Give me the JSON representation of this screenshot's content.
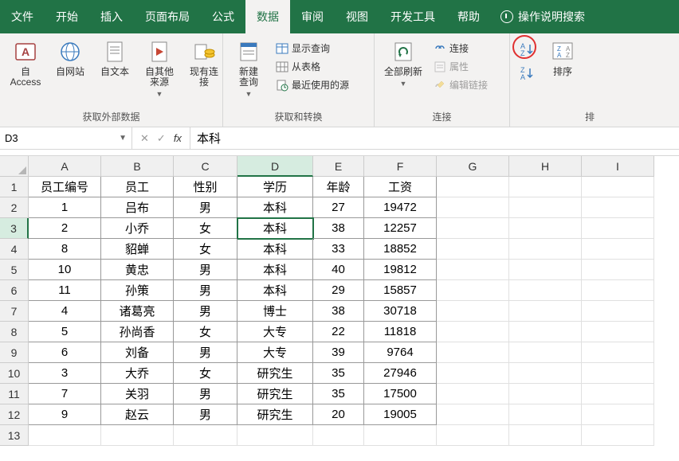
{
  "tabs": [
    "文件",
    "开始",
    "插入",
    "页面布局",
    "公式",
    "数据",
    "审阅",
    "视图",
    "开发工具",
    "帮助"
  ],
  "active_tab_index": 5,
  "tell_me": "操作说明搜索",
  "ribbon": {
    "group_ext": {
      "label": "获取外部数据",
      "btns": [
        "自 Access",
        "自网站",
        "自文本",
        "自其他来源",
        "现有连接"
      ]
    },
    "group_get": {
      "label": "获取和转换",
      "new_query": "新建\n查询",
      "show_query": "显示查询",
      "from_table": "从表格",
      "recent": "最近使用的源"
    },
    "group_conn": {
      "label": "连接",
      "refresh": "全部刷新",
      "connections": "连接",
      "properties": "属性",
      "edit_links": "编辑链接"
    },
    "group_sort": {
      "label": "排",
      "sort": "排序"
    }
  },
  "namebox": "D3",
  "formula": "本科",
  "columns": [
    "A",
    "B",
    "C",
    "D",
    "E",
    "F",
    "G",
    "H",
    "I"
  ],
  "active_col": "D",
  "active_row": 3,
  "data_rows": 12,
  "blank_rows": 1,
  "cells": {
    "1": {
      "A": "员工编号",
      "B": "员工",
      "C": "性别",
      "D": "学历",
      "E": "年龄",
      "F": "工资"
    },
    "2": {
      "A": "1",
      "B": "吕布",
      "C": "男",
      "D": "本科",
      "E": "27",
      "F": "19472"
    },
    "3": {
      "A": "2",
      "B": "小乔",
      "C": "女",
      "D": "本科",
      "E": "38",
      "F": "12257"
    },
    "4": {
      "A": "8",
      "B": "貂蝉",
      "C": "女",
      "D": "本科",
      "E": "33",
      "F": "18852"
    },
    "5": {
      "A": "10",
      "B": "黄忠",
      "C": "男",
      "D": "本科",
      "E": "40",
      "F": "19812"
    },
    "6": {
      "A": "11",
      "B": "孙策",
      "C": "男",
      "D": "本科",
      "E": "29",
      "F": "15857"
    },
    "7": {
      "A": "4",
      "B": "诸葛亮",
      "C": "男",
      "D": "博士",
      "E": "38",
      "F": "30718"
    },
    "8": {
      "A": "5",
      "B": "孙尚香",
      "C": "女",
      "D": "大专",
      "E": "22",
      "F": "11818"
    },
    "9": {
      "A": "6",
      "B": "刘备",
      "C": "男",
      "D": "大专",
      "E": "39",
      "F": "9764"
    },
    "10": {
      "A": "3",
      "B": "大乔",
      "C": "女",
      "D": "研究生",
      "E": "35",
      "F": "27946"
    },
    "11": {
      "A": "7",
      "B": "关羽",
      "C": "男",
      "D": "研究生",
      "E": "35",
      "F": "17500"
    },
    "12": {
      "A": "9",
      "B": "赵云",
      "C": "男",
      "D": "研究生",
      "E": "20",
      "F": "19005"
    }
  }
}
